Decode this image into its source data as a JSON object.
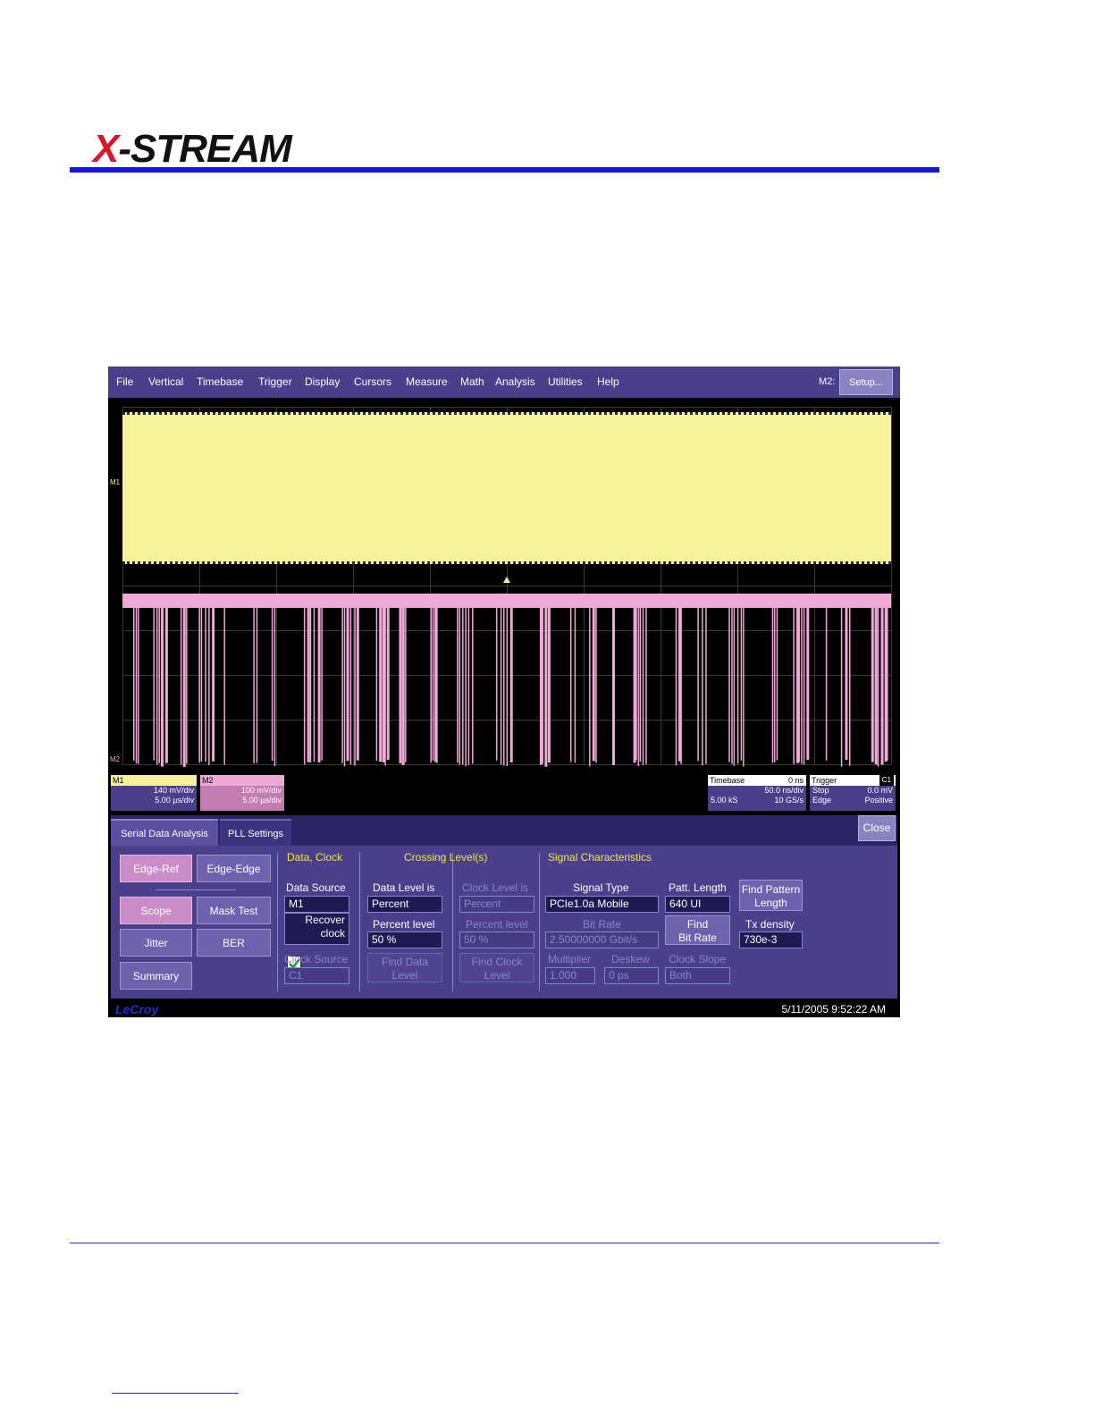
{
  "header": {
    "logo_text_x": "X",
    "logo_text_rest": "-STREAM"
  },
  "menu": [
    "File",
    "Vertical",
    "Timebase",
    "Trigger",
    "Display",
    "Cursors",
    "Measure",
    "Math",
    "Analysis",
    "Utilities",
    "Help"
  ],
  "toolbar": {
    "m2_label": "M2:",
    "setup_label": "Setup..."
  },
  "traces": {
    "m1_label": "M1",
    "m2_label": "M2"
  },
  "descriptors": {
    "m1": {
      "title": "M1",
      "line1": "140 mV/div",
      "line2": "5.00 µs/div"
    },
    "m2": {
      "title": "M2",
      "line1": "100 mV/div",
      "line2": "5.00 µs/div"
    },
    "timebase": {
      "title": "Timebase",
      "title_value": "0 ns",
      "r1": "50.0 ns/div",
      "r2a": "5.00 kS",
      "r2b": "10 GS/s"
    },
    "trigger": {
      "title": "Trigger",
      "badge": "C1",
      "r1a": "Stop",
      "r1b": "0.0 mV",
      "r2a": "Edge",
      "r2b": "Positive"
    }
  },
  "tabs": {
    "sda": "Serial Data Analysis",
    "pll": "PLL Settings",
    "close": "Close"
  },
  "left_buttons": {
    "edge_ref": "Edge-Ref",
    "edge_edge": "Edge-Edge",
    "scope": "Scope",
    "mask_test": "Mask Test",
    "jitter": "Jitter",
    "ber": "BER",
    "summary": "Summary"
  },
  "groups": {
    "data_clock": "Data, Clock",
    "crossing": "Crossing Level(s)",
    "signal": "Signal Characteristics"
  },
  "data_clock": {
    "data_source_label": "Data Source",
    "data_source_value": "M1",
    "recover_clock_l1": "Recover",
    "recover_clock_l2": "clock",
    "clock_source_label": "Clock Source",
    "clock_source_value": "C1"
  },
  "crossing": {
    "data_level_label": "Data Level is",
    "data_level_value": "Percent",
    "percent_level_label": "Percent level",
    "percent_level_value": "50 %",
    "find_data_l1": "Find Data",
    "find_data_l2": "Level",
    "clock_level_label": "Clock Level is",
    "clock_level_value": "Percent",
    "clock_percent_label": "Percent level",
    "clock_percent_value": "50 %",
    "find_clock_l1": "Find Clock",
    "find_clock_l2": "Level"
  },
  "signal": {
    "signal_type_label": "Signal Type",
    "signal_type_value": "PCIe1.0a Mobile",
    "bit_rate_label": "Bit Rate",
    "bit_rate_value": "2.50000000 Gbit/s",
    "multiplier_label": "Multiplier",
    "multiplier_value": "1.000",
    "deskew_label": "Deskew",
    "deskew_value": "0 ps",
    "patt_length_label": "Patt. Length",
    "patt_length_value": "640 UI",
    "find_bitrate_l1": "Find",
    "find_bitrate_l2": "Bit Rate",
    "clock_slope_label": "Clock Slope",
    "clock_slope_value": "Both",
    "find_pattern_l1": "Find Pattern",
    "find_pattern_l2": "Length",
    "tx_density_label": "Tx density",
    "tx_density_value": "730e-3"
  },
  "status": {
    "brand": "LeCroy",
    "datetime": "5/11/2005 9:52:22 AM"
  },
  "colors": {
    "m1_trace": "#f6f29c",
    "m2_trace": "#f0a8d6",
    "menu_bg": "#4a3f8a",
    "group_header": "#f2e83a",
    "rule": "#1414e6"
  }
}
